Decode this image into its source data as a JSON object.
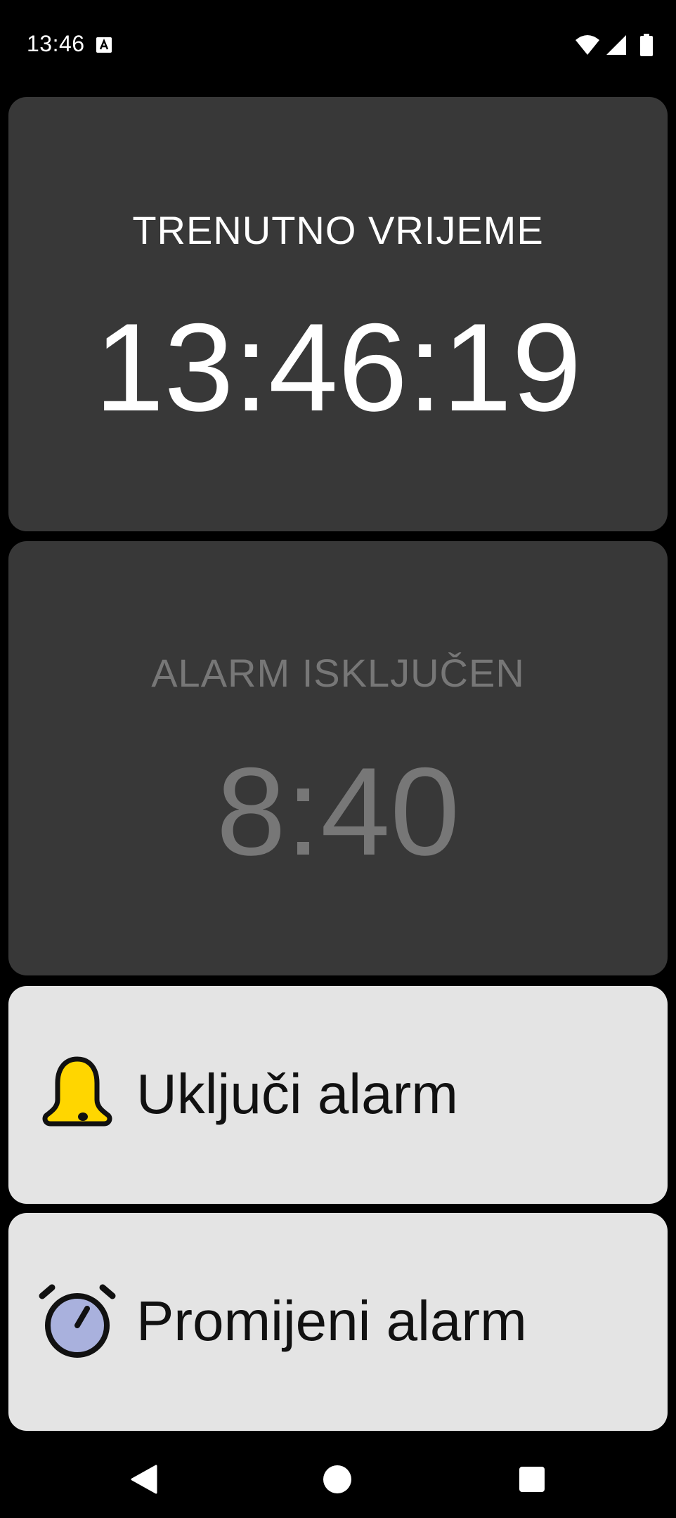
{
  "status_bar": {
    "time": "13:46",
    "app_icon": "a-notification-icon",
    "wifi_icon": "wifi-icon",
    "signal_icon": "signal-icon",
    "battery_icon": "battery-icon"
  },
  "clock": {
    "label": "TRENUTNO VRIJEME",
    "time": "13:46:19"
  },
  "alarm": {
    "label": "ALARM ISKLJUČEN",
    "time": "8:40"
  },
  "buttons": {
    "enable": {
      "label": "Uključi alarm",
      "icon": "bell-icon"
    },
    "change": {
      "label": "Promijeni alarm",
      "icon": "alarm-clock-icon"
    }
  },
  "nav_bar": {
    "back_icon": "back-icon",
    "home_icon": "home-icon",
    "recents_icon": "recents-icon"
  },
  "colors": {
    "background": "#000000",
    "panel_dark": "#383838",
    "panel_light": "#e4e4e4",
    "text_active": "#ffffff",
    "text_disabled": "#777777",
    "bell_yellow": "#ffd600",
    "clock_face": "#a9b1dd"
  }
}
